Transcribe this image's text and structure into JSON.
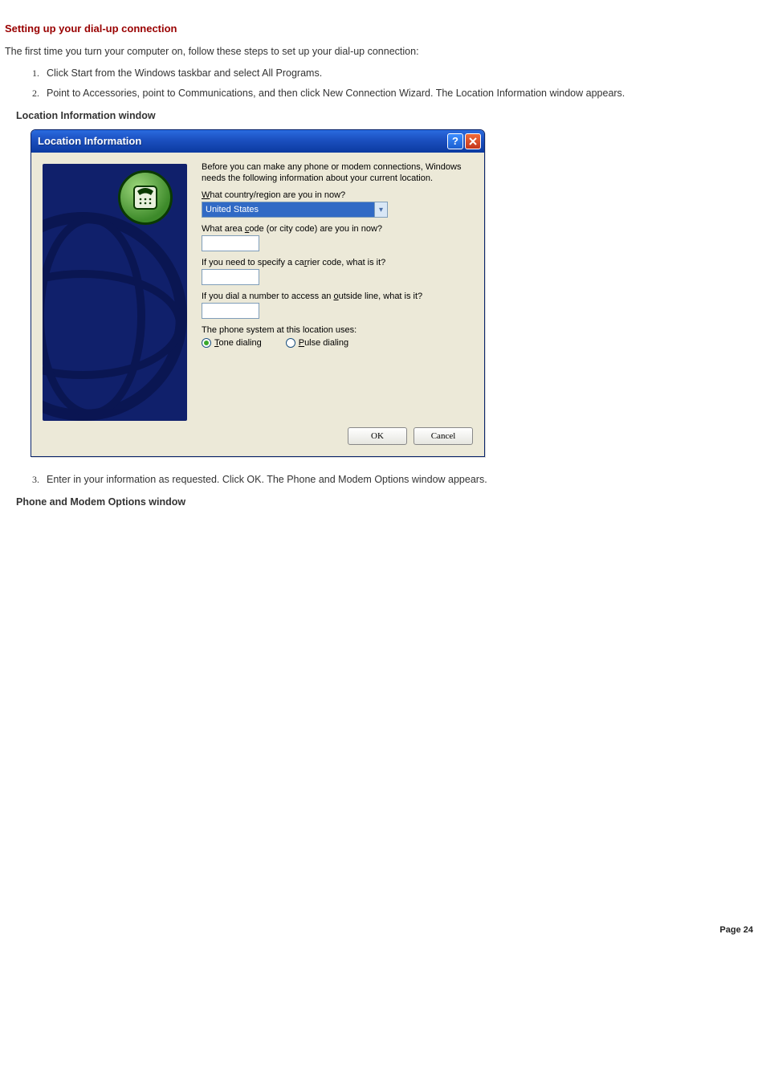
{
  "section_title": "Setting up your dial-up connection",
  "intro": "The first time you turn your computer on, follow these steps to set up your dial-up connection:",
  "steps_a": [
    "Click Start from the Windows taskbar and select All Programs.",
    "Point to Accessories, point to Communications, and then click New Connection Wizard. The Location Information window appears."
  ],
  "fig1_caption": "Location Information window",
  "dialog": {
    "title": "Location Information",
    "help_glyph": "?",
    "intro_text": "Before you can make any phone or modem connections, Windows needs the following information about your current location.",
    "country_label_pre": "W",
    "country_label_rest": "hat country/region are you in now?",
    "country_value": "United States",
    "area_label_a": "What area ",
    "area_label_u": "c",
    "area_label_b": "ode (or city code) are you in now?",
    "carrier_label_a": "If you need to specify a ca",
    "carrier_label_u": "r",
    "carrier_label_b": "rier code, what is it?",
    "outside_label_a": "If you dial a number to access an ",
    "outside_label_u": "o",
    "outside_label_b": "utside line, what is it?",
    "phone_sys_label": "The phone system at this location uses:",
    "tone_pre": "T",
    "tone_rest": "one dialing",
    "pulse_pre": "P",
    "pulse_rest": "ulse dialing",
    "ok": "OK",
    "cancel": "Cancel"
  },
  "steps_b": [
    "Enter in your information as requested. Click OK. The Phone and Modem Options window appears."
  ],
  "fig2_caption": "Phone and Modem Options window",
  "page_footer": "Page 24"
}
